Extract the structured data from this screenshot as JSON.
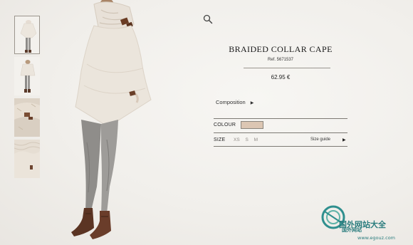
{
  "product": {
    "name": "BRAIDED COLLAR CAPE",
    "reference": "Ref. 5671537",
    "price": "62.95 €"
  },
  "composition": {
    "label": "Composition",
    "arrow": "▶"
  },
  "colour": {
    "label": "COLOUR",
    "swatch_color": "#dcc6b3"
  },
  "size": {
    "label": "SIZE",
    "options": [
      "XS",
      "S",
      "M"
    ],
    "guide_label": "Size guide",
    "guide_arrow": "▶"
  },
  "thumbnails": [
    "front-view",
    "back-view",
    "collar-detail",
    "knit-detail"
  ],
  "watermark": {
    "title": "国外网站大全",
    "subtitle": "国外网站",
    "url": "www.egouz.com"
  },
  "icons": {
    "search": "search-icon"
  }
}
